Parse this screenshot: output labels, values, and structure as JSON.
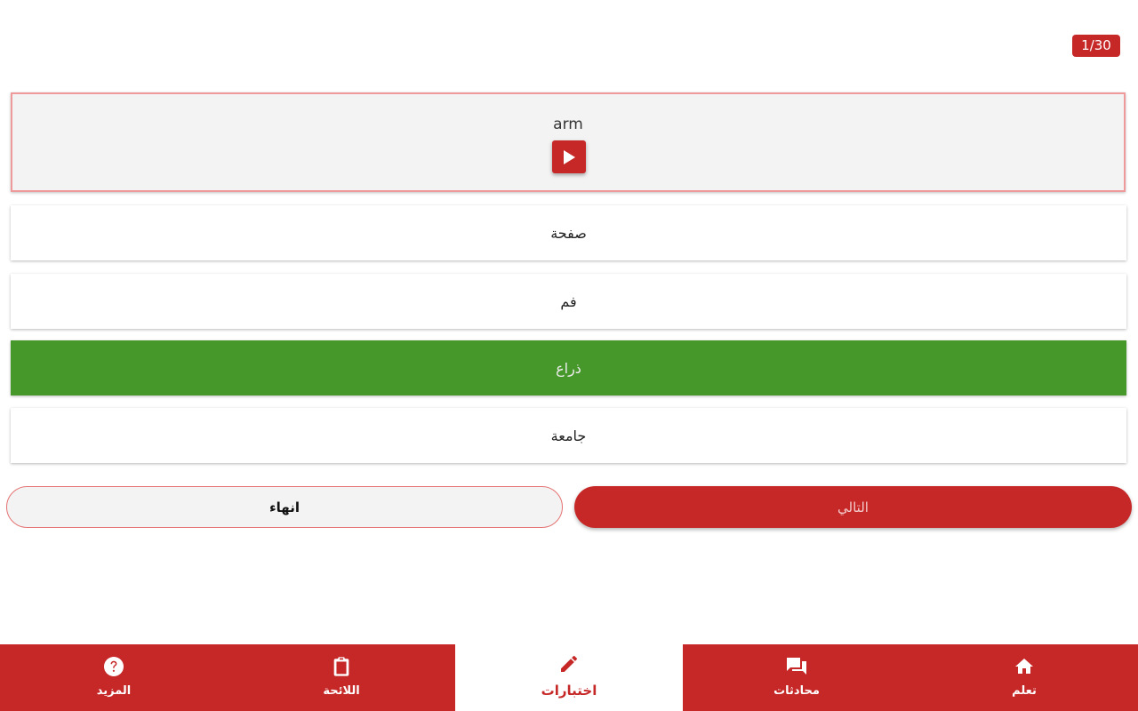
{
  "progress": {
    "counter": "1/30"
  },
  "question": {
    "word": "arm",
    "play_icon": "play-icon"
  },
  "options": [
    {
      "label": "صفحة",
      "state": "default"
    },
    {
      "label": "فم",
      "state": "default"
    },
    {
      "label": "ذراع",
      "state": "correct"
    },
    {
      "label": "جامعة",
      "state": "default"
    }
  ],
  "actions": {
    "finish_label": "انهاء",
    "next_label": "التالي"
  },
  "bottom_nav": {
    "items": [
      {
        "label": "المزيد",
        "icon": "help-circle-icon",
        "active": false
      },
      {
        "label": "اللائحة",
        "icon": "clipboard-icon",
        "active": false
      },
      {
        "label": "اختبارات",
        "icon": "pencil-icon",
        "active": true
      },
      {
        "label": "محادثات",
        "icon": "chat-icon",
        "active": false
      },
      {
        "label": "تعلم",
        "icon": "home-icon",
        "active": false
      }
    ]
  },
  "colors": {
    "accent": "#c62828",
    "correct": "#47982b",
    "border_light": "#ef9a9a"
  }
}
